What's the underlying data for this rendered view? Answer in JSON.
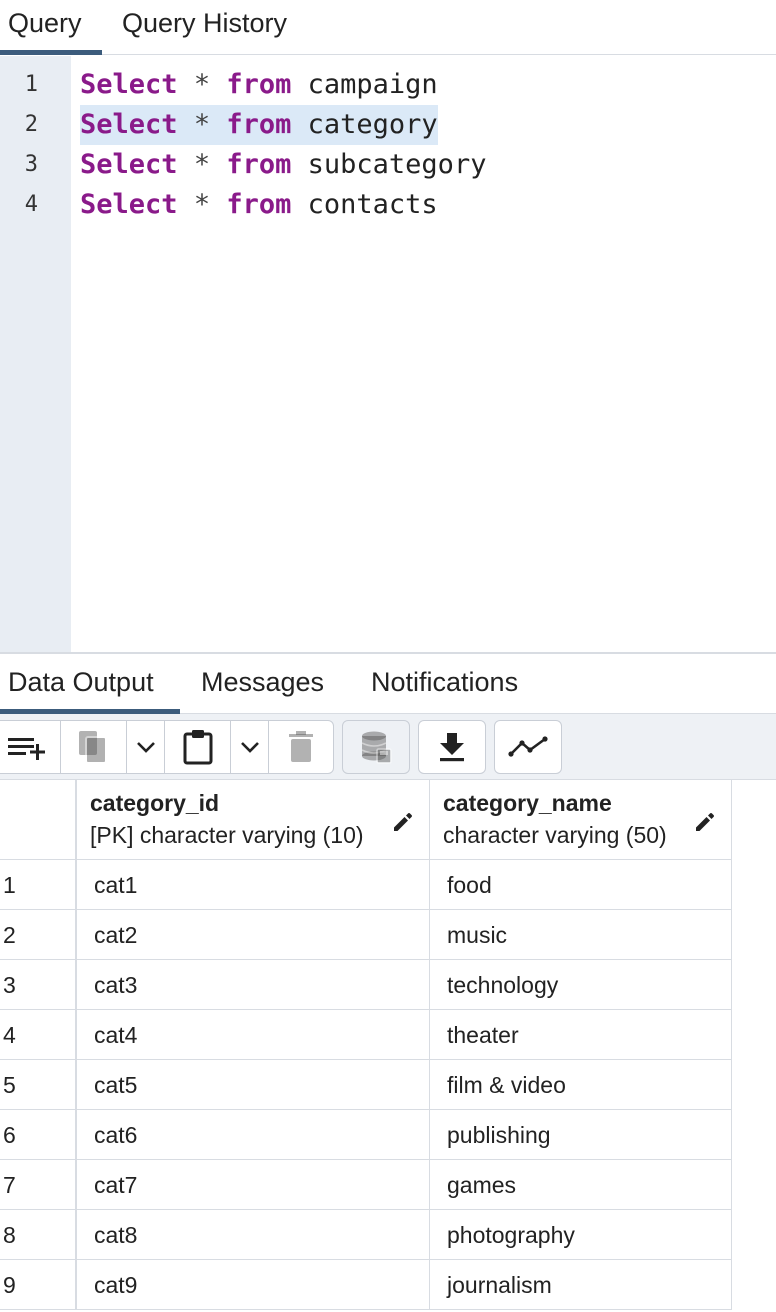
{
  "top_tabs": {
    "query": "Query",
    "query_history": "Query History"
  },
  "editor": {
    "lines": [
      {
        "num": "1",
        "kw1": "Select",
        "op": "*",
        "kw2": "from",
        "table": "campaign"
      },
      {
        "num": "2",
        "kw1": "Select",
        "op": "*",
        "kw2": "from",
        "table": "category"
      },
      {
        "num": "3",
        "kw1": "Select",
        "op": "*",
        "kw2": "from",
        "table": "subcategory"
      },
      {
        "num": "4",
        "kw1": "Select",
        "op": "*",
        "kw2": "from",
        "table": "contacts"
      }
    ]
  },
  "output_tabs": {
    "data_output": "Data Output",
    "messages": "Messages",
    "notifications": "Notifications"
  },
  "toolbar": {
    "icons": [
      "add-row-icon",
      "copy-icon",
      "chevron-down-icon",
      "paste-icon",
      "chevron-down-icon",
      "delete-icon",
      "save-data-icon",
      "download-icon",
      "graph-icon"
    ]
  },
  "grid": {
    "columns": [
      {
        "name": "category_id",
        "type": "[PK] character varying (10)"
      },
      {
        "name": "category_name",
        "type": "character varying (50)"
      }
    ],
    "rows": [
      {
        "n": "1",
        "id": "cat1",
        "name": "food"
      },
      {
        "n": "2",
        "id": "cat2",
        "name": "music"
      },
      {
        "n": "3",
        "id": "cat3",
        "name": "technology"
      },
      {
        "n": "4",
        "id": "cat4",
        "name": "theater"
      },
      {
        "n": "5",
        "id": "cat5",
        "name": "film & video"
      },
      {
        "n": "6",
        "id": "cat6",
        "name": "publishing"
      },
      {
        "n": "7",
        "id": "cat7",
        "name": "games"
      },
      {
        "n": "8",
        "id": "cat8",
        "name": "photography"
      },
      {
        "n": "9",
        "id": "cat9",
        "name": "journalism"
      }
    ]
  },
  "colors": {
    "keyword": "#8a1a8a",
    "active_tab_underline": "#3c5c7c",
    "gutter": "#e8edf3",
    "selection": "#dbe9f7"
  }
}
